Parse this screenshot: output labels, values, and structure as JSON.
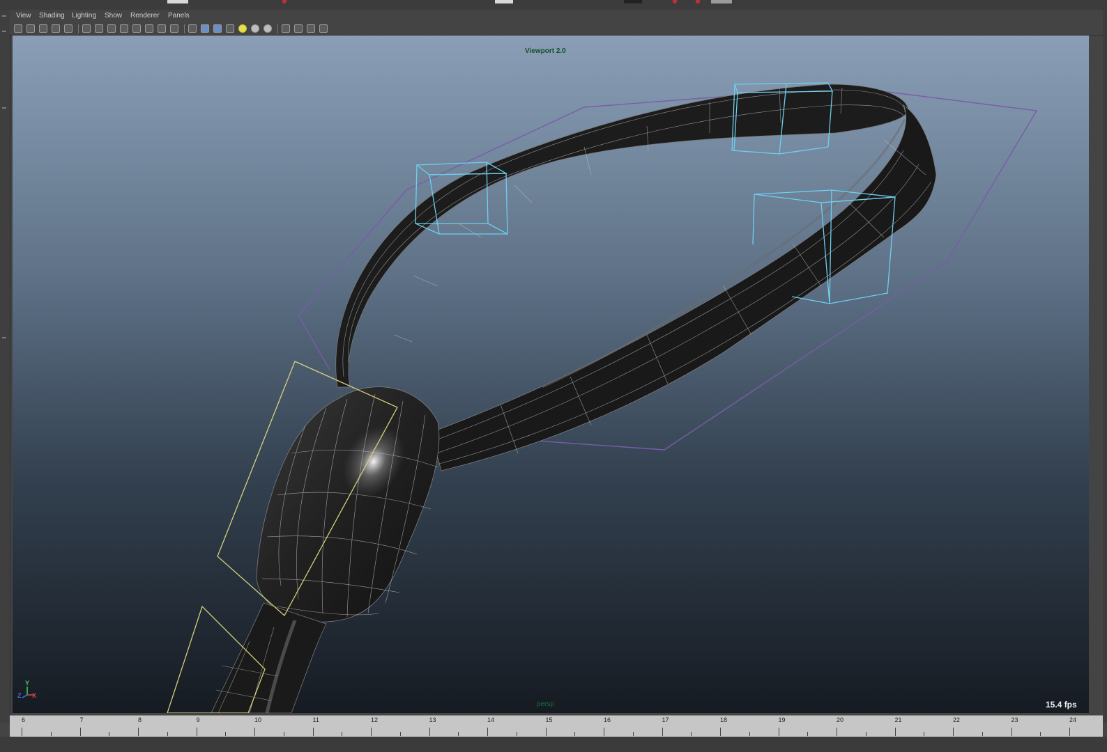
{
  "menubar": {
    "items": [
      "View",
      "Shading",
      "Lighting",
      "Show",
      "Renderer",
      "Panels"
    ]
  },
  "toolbar": {
    "icons": [
      "camera-select-icon",
      "camera-attributes-icon",
      "bookmark-icon",
      "image-plane-icon",
      "two-d-pan-icon",
      "grease-pencil-icon",
      "grid-icon",
      "film-gate-icon",
      "resolution-gate-icon",
      "gate-mask-icon",
      "field-chart-icon",
      "safe-action-icon",
      "safe-title-icon",
      "wireframe-icon",
      "smooth-shade-icon",
      "wireframe-on-shaded-icon",
      "xray-icon",
      "default-lighting-icon",
      "shadows-icon",
      "ambient-occlusion-icon",
      "isolate-select-icon",
      "xray-joints-icon",
      "backface-culling-icon",
      "node-editor-icon"
    ]
  },
  "viewport": {
    "renderer_label": "Viewport 2.0",
    "camera_label": "persp",
    "fps": "15.4 fps",
    "axis": {
      "y": "Y",
      "z": "Z",
      "x": "X"
    }
  },
  "timeline": {
    "frames": [
      "6",
      "7",
      "8",
      "9",
      "10",
      "11",
      "12",
      "13",
      "14",
      "15",
      "16",
      "17",
      "18",
      "19",
      "20",
      "21",
      "22",
      "23",
      "24"
    ]
  },
  "colors": {
    "viewport_top": "#8a9fb6",
    "viewport_bottom": "#161b22",
    "cube_wire": "#6ed0ef",
    "nurbs_curve": "#7a5ca8",
    "plane_outline": "#d8d07a",
    "mesh": "#1f1f1f"
  }
}
